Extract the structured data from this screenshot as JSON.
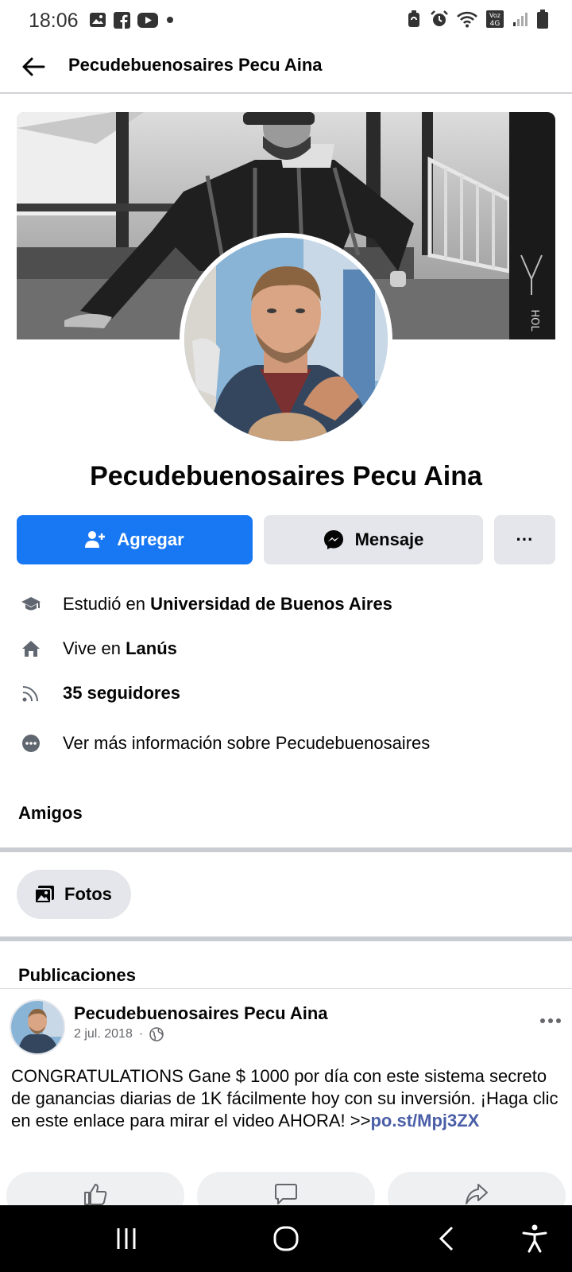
{
  "status_bar": {
    "time": "18:06",
    "left_icons": [
      "gallery-icon",
      "facebook-icon",
      "youtube-icon",
      "dot-icon"
    ],
    "right_icons": [
      "battery-saver-icon",
      "alarm-icon",
      "wifi-icon",
      "volte-4g-icon",
      "signal-icon",
      "battery-icon"
    ]
  },
  "header": {
    "title": "Pecudebuenosaires Pecu Aina"
  },
  "profile": {
    "name": "Pecudebuenosaires Pecu Aina"
  },
  "actions": {
    "add_label": "Agregar",
    "message_label": "Mensaje",
    "more_label": "···"
  },
  "info": {
    "studied_prefix": "Estudió en ",
    "studied_value": "Universidad de Buenos Aires",
    "lives_prefix": "Vive en ",
    "lives_value": "Lanús",
    "followers": "35 seguidores",
    "more_info": "Ver más información sobre Pecudebuenosaires"
  },
  "sections": {
    "friends": "Amigos",
    "photos_chip": "Fotos",
    "posts": "Publicaciones"
  },
  "post": {
    "author": "Pecudebuenosaires Pecu Aina",
    "date": "2 jul. 2018",
    "separator": "·",
    "privacy_icon": "globe-icon",
    "text": "CONGRATULATIONS Gane $ 1000 por día con este sistema secreto de ganancias diarias de 1K fácilmente hoy con su inversión. ¡Haga clic en este enlace para mirar el video AHORA! >>",
    "link": "po.st/Mpj3ZX"
  },
  "colors": {
    "accent": "#1877f2",
    "button_gray": "#e4e6eb",
    "link": "#4b5fa8",
    "divider": "#c9ccd1"
  }
}
